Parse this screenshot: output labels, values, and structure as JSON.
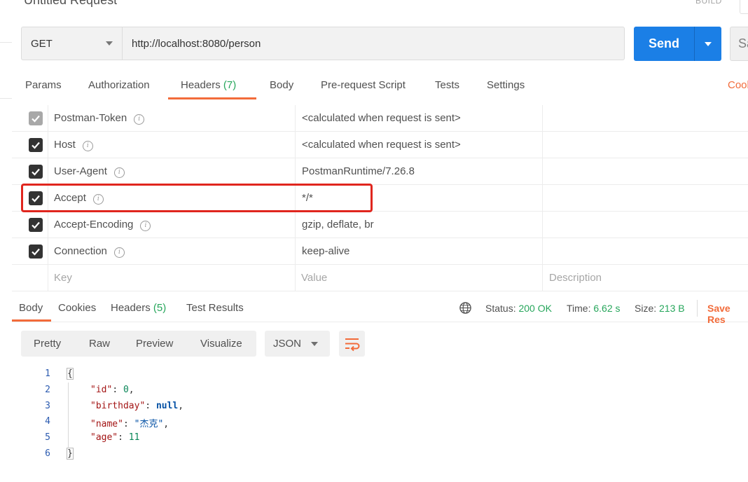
{
  "request": {
    "title": "Untitled Request",
    "build_label": "BUILD",
    "method": "GET",
    "url": "http://localhost:8080/person",
    "send_label": "Send",
    "save_label": "Sa"
  },
  "request_tabs": [
    {
      "label": "Params"
    },
    {
      "label": "Authorization"
    },
    {
      "label": "Headers",
      "count": "(7)",
      "active": true
    },
    {
      "label": "Body"
    },
    {
      "label": "Pre-request Script"
    },
    {
      "label": "Tests"
    },
    {
      "label": "Settings"
    }
  ],
  "cookies_link": "Cook",
  "headers": {
    "rows": [
      {
        "key": "Postman-Token",
        "value": "<calculated when request is sent>",
        "checked": true,
        "disabled": true
      },
      {
        "key": "Host",
        "value": "<calculated when request is sent>",
        "checked": true
      },
      {
        "key": "User-Agent",
        "value": "PostmanRuntime/7.26.8",
        "checked": true
      },
      {
        "key": "Accept",
        "value": "*/*",
        "checked": true,
        "highlighted": true
      },
      {
        "key": "Accept-Encoding",
        "value": "gzip, deflate, br",
        "checked": true
      },
      {
        "key": "Connection",
        "value": "keep-alive",
        "checked": true
      }
    ],
    "placeholders": {
      "key": "Key",
      "value": "Value",
      "description": "Description"
    },
    "info_glyph": "i"
  },
  "response_tabs": [
    {
      "label": "Body",
      "active": true
    },
    {
      "label": "Cookies"
    },
    {
      "label": "Headers",
      "count": "(5)"
    },
    {
      "label": "Test Results"
    }
  ],
  "status": {
    "status_label": "Status:",
    "status_value": "200 OK",
    "time_label": "Time:",
    "time_value": "6.62 s",
    "size_label": "Size:",
    "size_value": "213 B",
    "save_response": "Save Res"
  },
  "format_toolbar": {
    "buttons": [
      "Pretty",
      "Raw",
      "Preview",
      "Visualize"
    ],
    "selected_format": "JSON"
  },
  "code": {
    "line_numbers": [
      "1",
      "2",
      "3",
      "4",
      "5",
      "6"
    ],
    "open_brace": "{",
    "close_brace": "}",
    "fields": [
      {
        "key": "\"id\"",
        "value": "0",
        "type": "number",
        "comma": true
      },
      {
        "key": "\"birthday\"",
        "value": "null",
        "type": "null",
        "comma": true
      },
      {
        "key": "\"name\"",
        "value": "\"杰克\"",
        "type": "string",
        "comma": true
      },
      {
        "key": "\"age\"",
        "value": "11",
        "type": "number",
        "comma": false
      }
    ]
  },
  "colors": {
    "accent": "#f26b3a",
    "send_blue": "#1b7fe6",
    "status_green": "#26a65b",
    "highlight_red": "#e0261e"
  }
}
